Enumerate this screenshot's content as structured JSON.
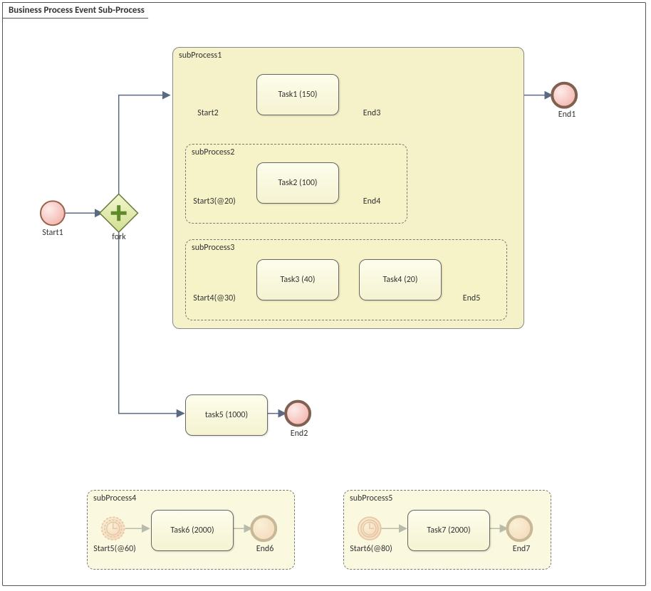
{
  "title": "Business Process Event Sub-Process",
  "nodes": {
    "start1": "Start1",
    "fork": "fork",
    "subProcess1": "subProcess1",
    "start2": "Start2",
    "task1": "Task1 (150)",
    "end3": "End3",
    "subProcess2": "subProcess2",
    "start3": "Start3(@20)",
    "task2": "Task2 (100)",
    "end4": "End4",
    "subProcess3": "subProcess3",
    "start4": "Start4(@30)",
    "task3": "Task3 (40)",
    "task4": "Task4 (20)",
    "end5": "End5",
    "end1": "End1",
    "task5": "task5 (1000)",
    "end2": "End2",
    "subProcess4": "subProcess4",
    "start5": "Start5(@60)",
    "task6": "Task6 (2000)",
    "end6": "End6",
    "subProcess5": "subProcess5",
    "start6": "Start6(@80)",
    "task7": "Task7 (2000)",
    "end7": "End7"
  }
}
